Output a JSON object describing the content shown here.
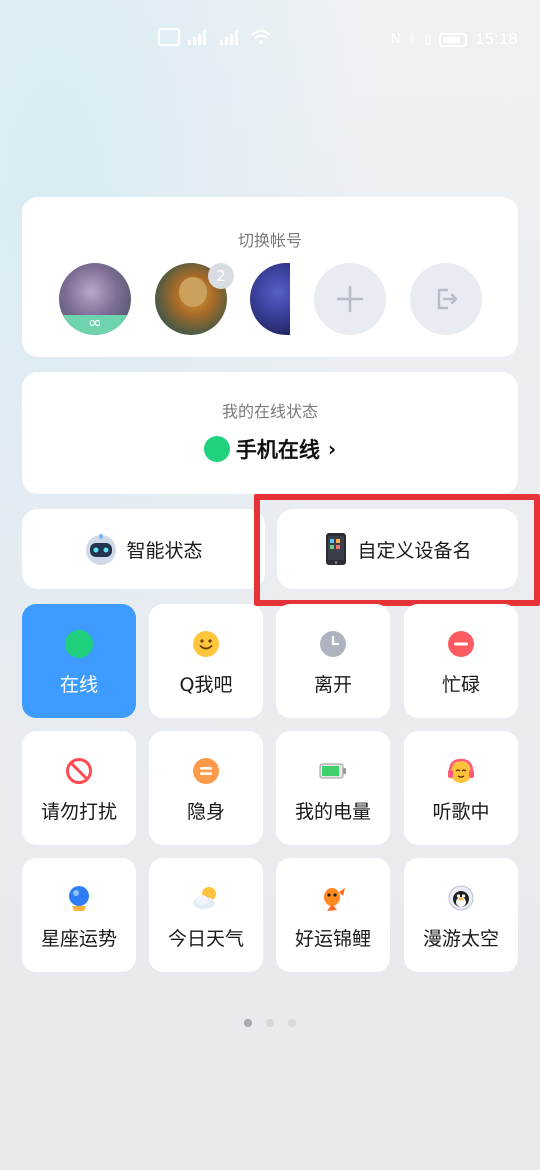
{
  "status_bar": {
    "time": "15:18",
    "battery_level": 0.7,
    "icons": [
      "hd-icon",
      "signal-icon",
      "signal-icon",
      "wifi-icon",
      "nfc-icon",
      "bluetooth-icon",
      "vibrate-icon",
      "battery-icon"
    ]
  },
  "account_switch": {
    "title": "切换帐号",
    "badge_count": "2",
    "actions": [
      "add-account-icon",
      "logout-icon"
    ]
  },
  "online_status": {
    "title": "我的在线状态",
    "current": "手机在线",
    "chevron": "›"
  },
  "quick_cards": {
    "smart_status": "智能状态",
    "custom_device_name": "自定义设备名"
  },
  "status_tiles": [
    {
      "label": "在线",
      "icon": "online-dot-icon",
      "color": "#1ed07c",
      "active": true
    },
    {
      "label": "Q我吧",
      "icon": "smile-icon",
      "color": "#ffc53d"
    },
    {
      "label": "离开",
      "icon": "clock-icon",
      "color": "#aeb4bf"
    },
    {
      "label": "忙碌",
      "icon": "busy-minus-icon",
      "color": "#ff5a5f"
    },
    {
      "label": "请勿打扰",
      "icon": "do-not-disturb-icon",
      "color": "#ff4a52"
    },
    {
      "label": "隐身",
      "icon": "invisible-icon",
      "color": "#ff9a4a"
    },
    {
      "label": "我的电量",
      "icon": "battery-level-icon",
      "color": "#3fcf6b"
    },
    {
      "label": "听歌中",
      "icon": "headphones-emoji-icon",
      "color": "#ffc23d"
    },
    {
      "label": "星座运势",
      "icon": "crystal-ball-icon",
      "color": "#2f7ef6"
    },
    {
      "label": "今日天气",
      "icon": "weather-sun-cloud-icon",
      "color": "#ffc23d"
    },
    {
      "label": "好运锦鲤",
      "icon": "koi-fish-icon",
      "color": "#ff8a1f"
    },
    {
      "label": "漫游太空",
      "icon": "qq-penguin-astronaut-icon",
      "color": "#222222"
    }
  ],
  "pager": {
    "pages": 3,
    "current": 1
  }
}
